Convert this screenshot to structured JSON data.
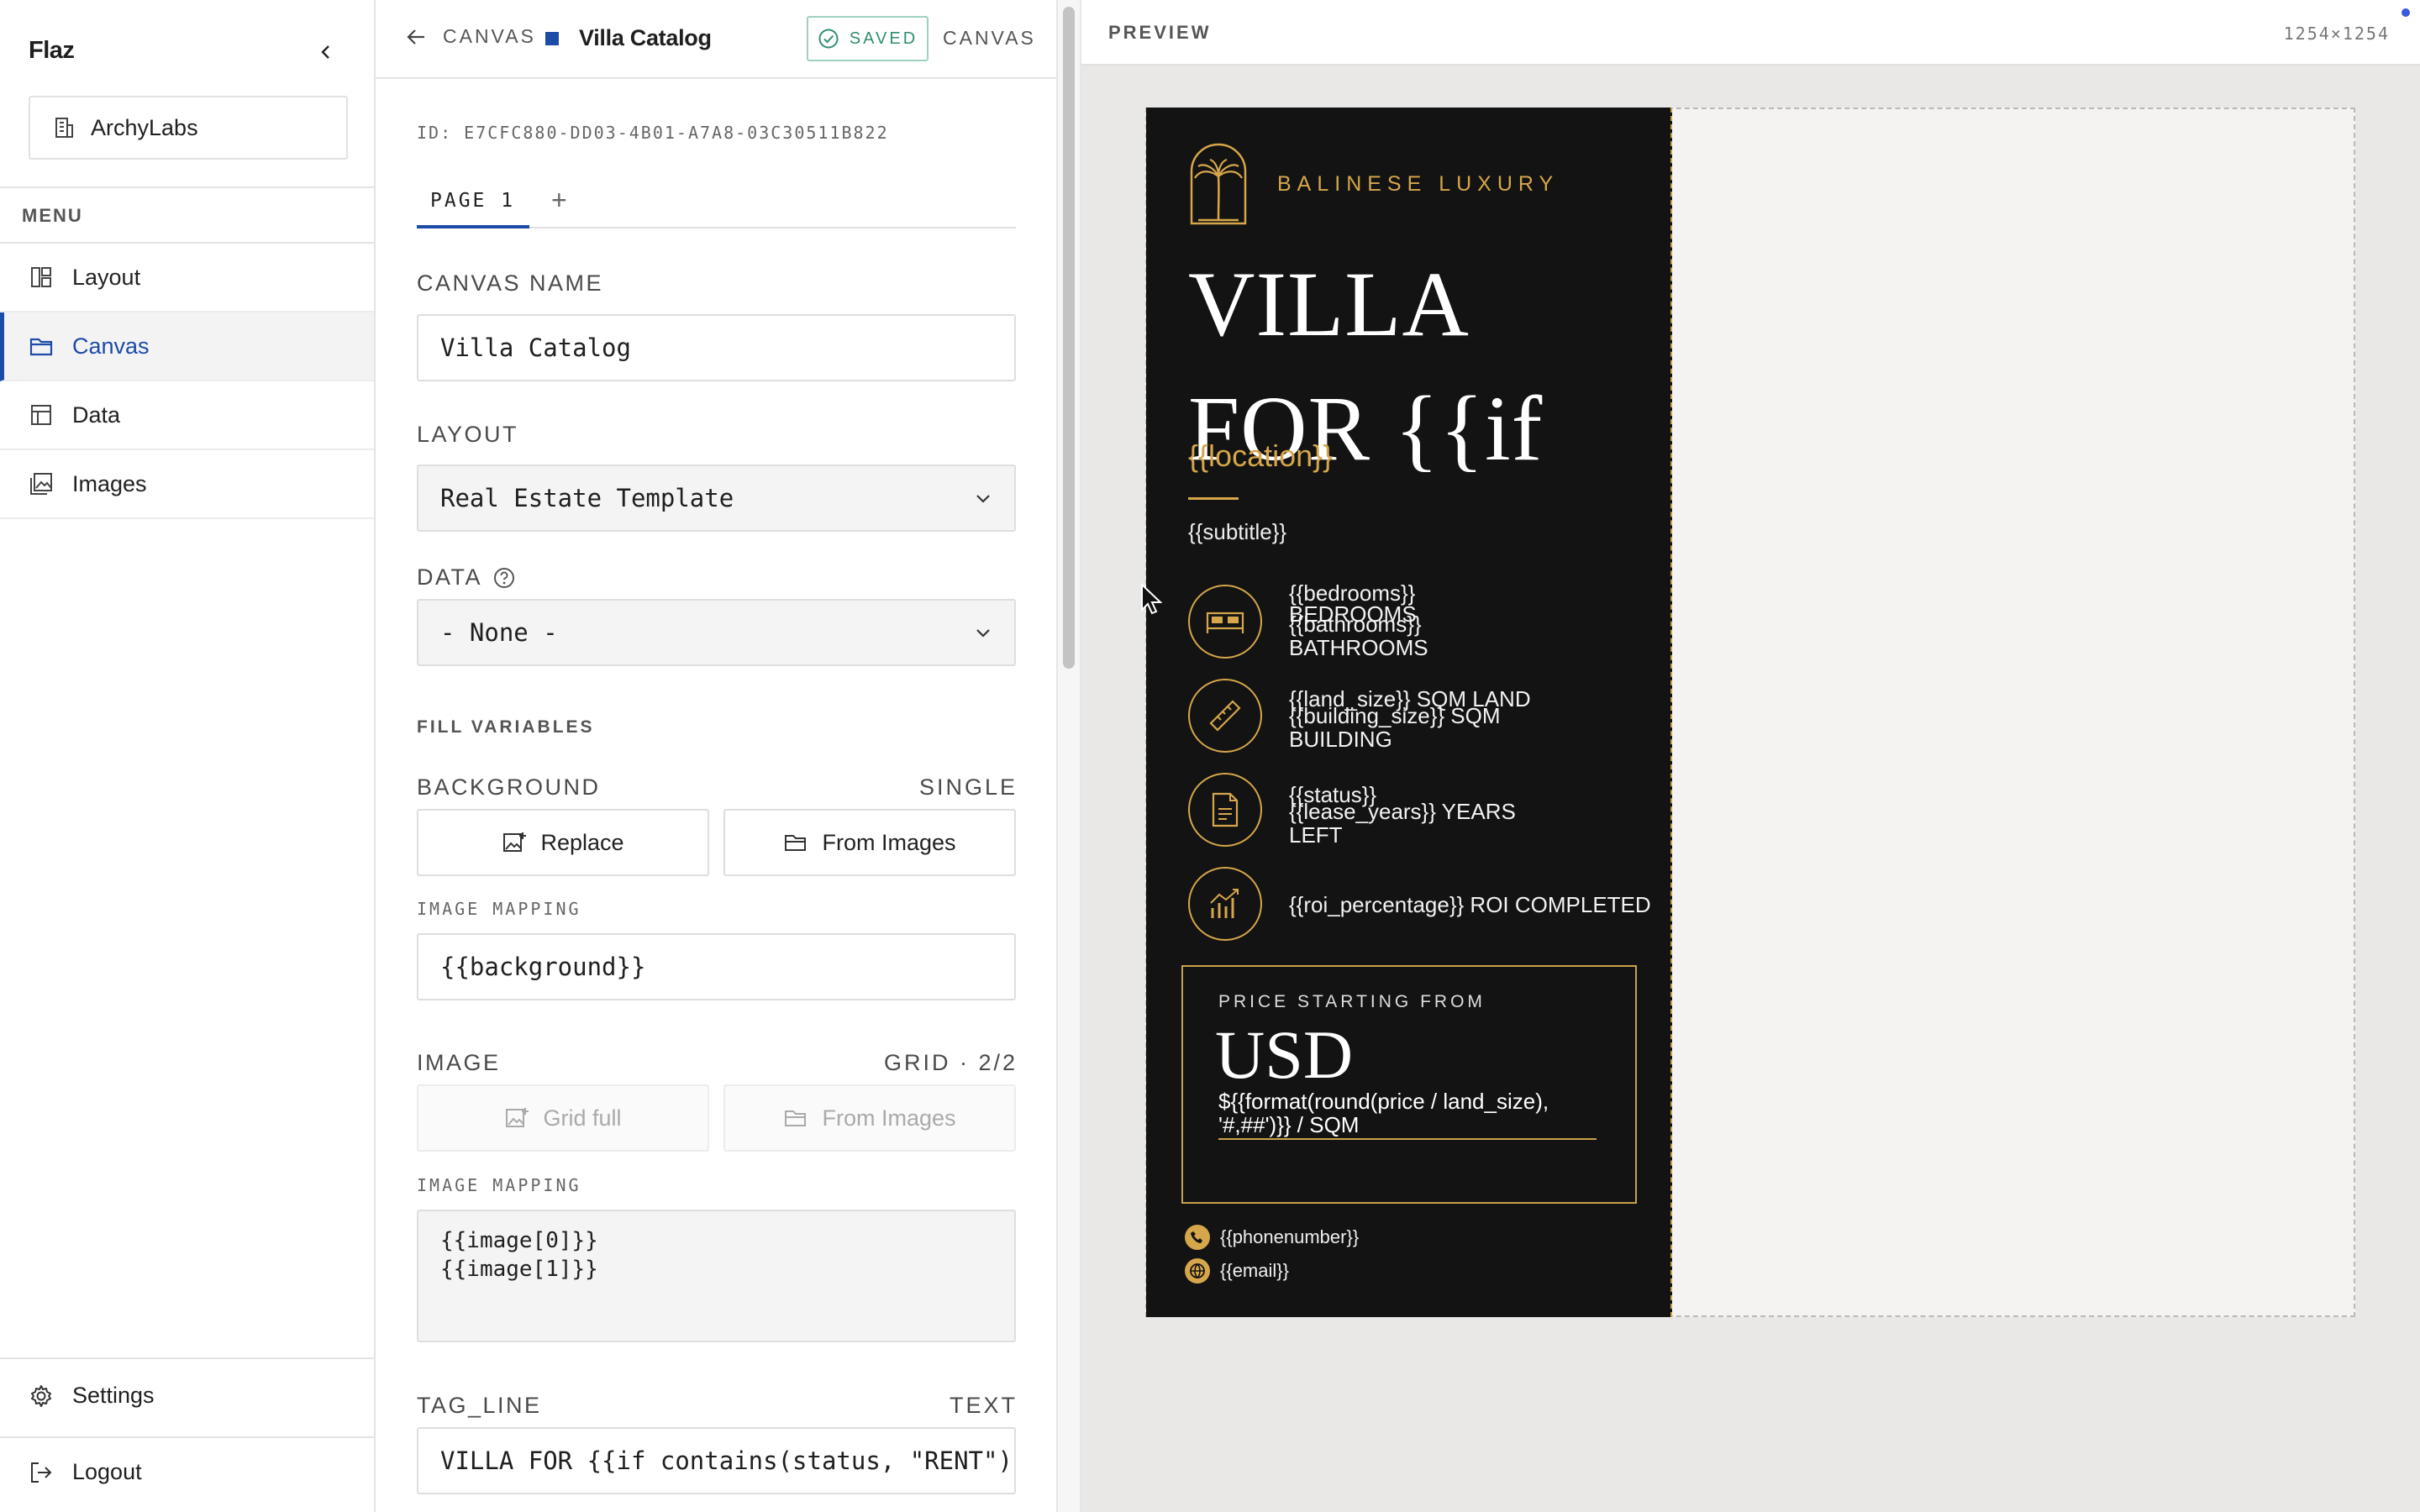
{
  "sidebar": {
    "brand": "Flaz",
    "workspace": "ArchyLabs",
    "menu_heading": "MENU",
    "items": [
      {
        "label": "Layout",
        "icon": "layout-icon"
      },
      {
        "label": "Canvas",
        "icon": "folder-icon",
        "active": true
      },
      {
        "label": "Data",
        "icon": "table-icon"
      },
      {
        "label": "Images",
        "icon": "images-icon"
      }
    ],
    "settings": "Settings",
    "logout": "Logout"
  },
  "editor": {
    "breadcrumb": "CANVAS",
    "title": "Villa Catalog",
    "saved_label": "SAVED",
    "header_right": "CANVAS",
    "id_text": "ID: E7CFC880-DD03-4B01-A7A8-03C30511B822",
    "tabs": [
      "PAGE 1"
    ],
    "canvas_name_label": "CANVAS NAME",
    "canvas_name_value": "Villa Catalog",
    "layout_label": "LAYOUT",
    "layout_value": "Real Estate Template",
    "data_label": "DATA",
    "data_value": "- None -",
    "fill_variables_label": "FILL VARIABLES",
    "background": {
      "label": "BACKGROUND",
      "kind": "SINGLE",
      "replace": "Replace",
      "from_images": "From Images",
      "mapping_label": "IMAGE MAPPING",
      "mapping_value": "{{background}}"
    },
    "image": {
      "label": "IMAGE",
      "kind": "GRID · 2/2",
      "grid_full": "Grid full",
      "from_images": "From Images",
      "mapping_label": "IMAGE MAPPING",
      "mapping_value": "{{image[0]}}\n{{image[1]}}"
    },
    "tag_line": {
      "label": "TAG_LINE",
      "kind": "TEXT",
      "value": "VILLA FOR {{if contains(status, \"RENT\")"
    }
  },
  "preview": {
    "title": "PREVIEW",
    "size": "1254×1254",
    "poster": {
      "brand": "BALINESE LUXURY",
      "headline_1": "VILLA",
      "headline_2": "FOR {{if",
      "location": "{{location}}",
      "subtitle": "{{subtitle}}",
      "features": [
        {
          "icon": "bed-icon",
          "lines": [
            "{{bedrooms}}",
            "BEDROOMS",
            "{{bathrooms}}",
            "BATHROOMS"
          ]
        },
        {
          "icon": "ruler-icon",
          "lines": [
            "{{land_size}} SQM LAND",
            "{{building_size}} SQM",
            "BUILDING"
          ]
        },
        {
          "icon": "document-icon",
          "lines": [
            "{{status}}",
            "{{lease_years}} YEARS",
            "LEFT"
          ]
        },
        {
          "icon": "growth-chart-icon",
          "lines": [
            "{{roi_percentage}} ROI COMPLETED"
          ]
        }
      ],
      "price_label": "PRICE STARTING FROM",
      "price_currency": "USD",
      "price_formula": "${{format(round(price / land_size), '#,##')}} / SQM",
      "phone": "{{phonenumber}}",
      "email": "{{email}}"
    }
  },
  "colors": {
    "accent": "#1d4ba8",
    "gold": "#d6a64a",
    "poster_bg": "#131313",
    "saved": "#2f8f6e"
  }
}
